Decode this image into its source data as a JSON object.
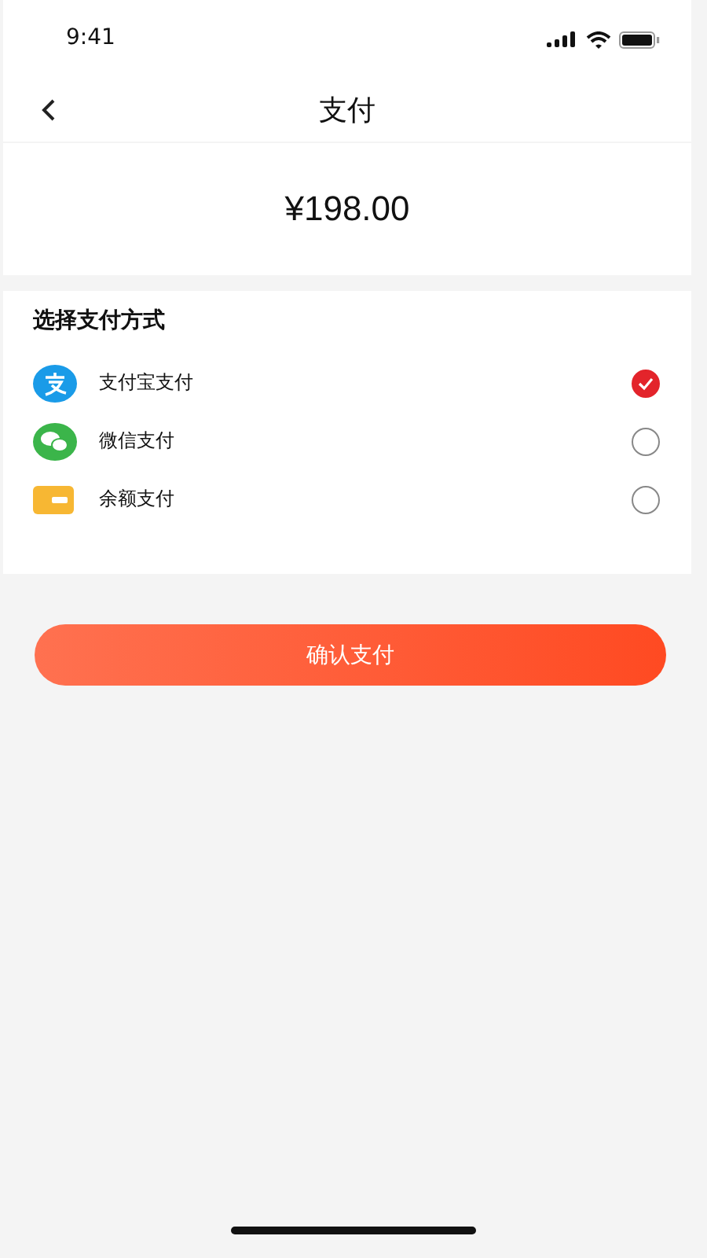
{
  "status_bar": {
    "time": "9:41"
  },
  "nav": {
    "title": "支付"
  },
  "amount": "¥198.00",
  "methods_section": {
    "title": "选择支付方式",
    "methods": [
      {
        "kind": "alipay",
        "label": "支付宝支付",
        "selected": true
      },
      {
        "kind": "wechat",
        "label": "微信支付",
        "selected": false
      },
      {
        "kind": "balance",
        "label": "余额支付",
        "selected": false
      }
    ]
  },
  "confirm_button": "确认支付"
}
